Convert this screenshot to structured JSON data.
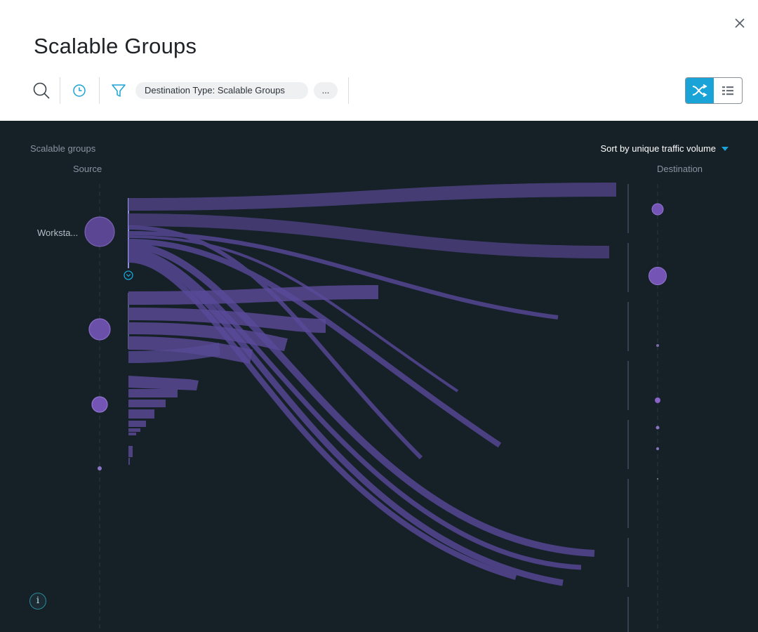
{
  "dialog": {
    "title": "Scalable Groups"
  },
  "toolbar": {
    "filter_chip": "Destination Type: Scalable Groups",
    "more_chip": "...",
    "view_mode": "flow"
  },
  "panel": {
    "section_label": "Scalable groups",
    "source_header": "Source",
    "destination_header": "Destination",
    "sort_label": "Sort by unique traffic volume",
    "source_nodes": [
      {
        "label": "Worksta...",
        "emphasis": "high"
      },
      {
        "label": "",
        "emphasis": "medium"
      },
      {
        "label": "",
        "emphasis": "medium"
      },
      {
        "label": "",
        "emphasis": "low"
      }
    ],
    "info_label": "i"
  },
  "colors": {
    "accent": "#1aa3d6",
    "panel_bg": "#152027",
    "flow": "#5a4a8e",
    "node": "#7b5aae"
  }
}
